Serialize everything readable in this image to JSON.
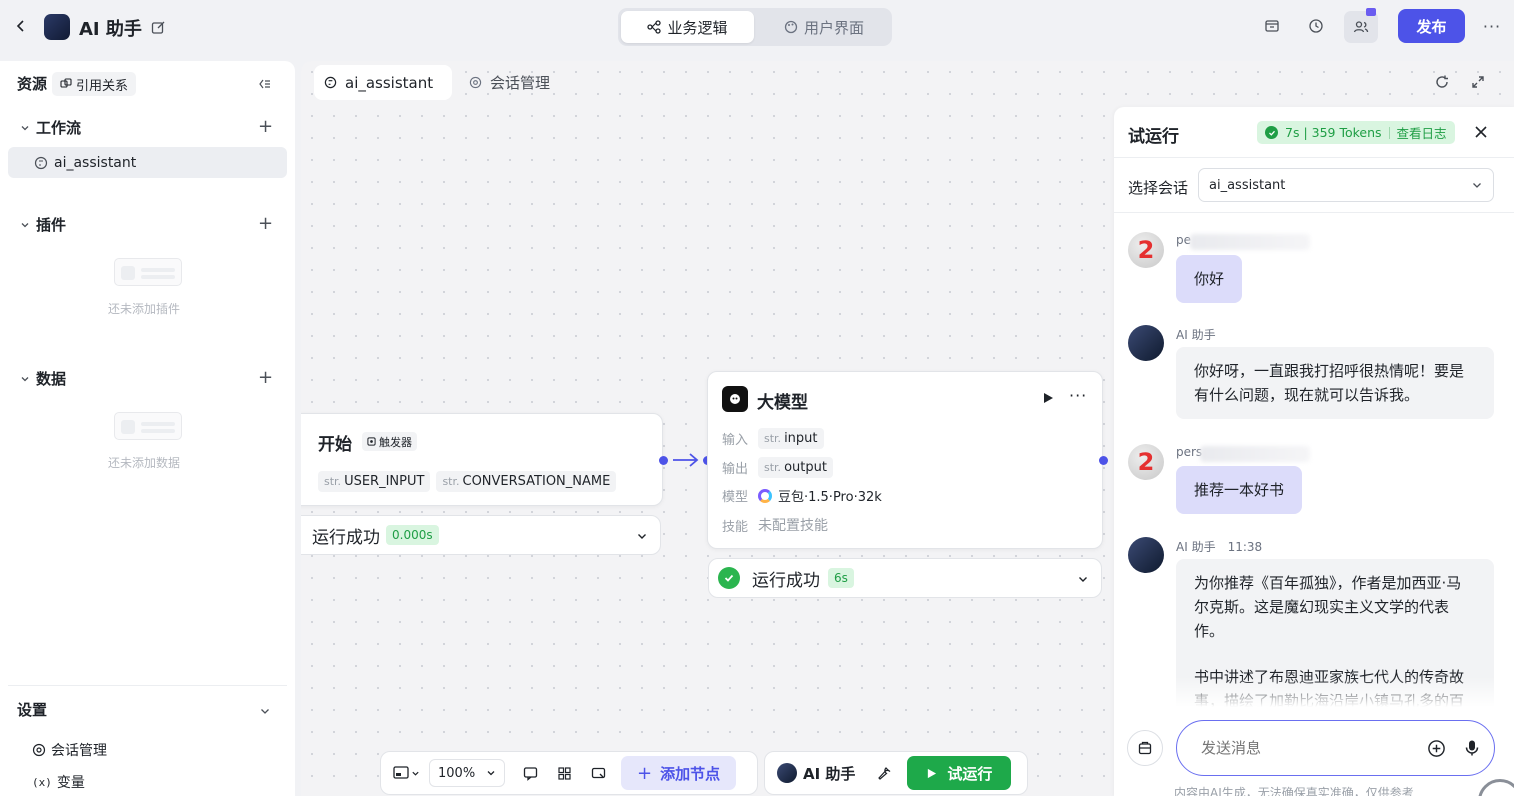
{
  "header": {
    "app_title": "AI 助手",
    "tabs": [
      {
        "label": "业务逻辑",
        "active": true
      },
      {
        "label": "用户界面",
        "active": false
      }
    ],
    "publish_label": "发布"
  },
  "sidebar": {
    "title": "资源",
    "ref_label": "引用关系",
    "workflow_title": "工作流",
    "workflow_items": [
      "ai_assistant"
    ],
    "plugin_title": "插件",
    "plugin_empty": "还未添加插件",
    "data_title": "数据",
    "data_empty": "还未添加数据",
    "settings_title": "设置",
    "settings_items": [
      "会话管理",
      "变量"
    ]
  },
  "canvas": {
    "tabs": [
      "ai_assistant",
      "会话管理"
    ],
    "start_node": {
      "title": "开始",
      "badge": "触发器",
      "params": [
        {
          "type": "str.",
          "name": "USER_INPUT"
        },
        {
          "type": "str.",
          "name": "CONVERSATION_NAME"
        }
      ],
      "status": "运行成功",
      "time": "0.000s"
    },
    "llm_node": {
      "title": "大模型",
      "input_label": "输入",
      "input_type": "str.",
      "input_name": "input",
      "output_label": "输出",
      "output_type": "str.",
      "output_name": "output",
      "model_label": "模型",
      "model_name": "豆包·1.5·Pro·32k",
      "skill_label": "技能",
      "skill_value": "未配置技能",
      "status": "运行成功",
      "time": "6s"
    },
    "toolbar": {
      "zoom": "100%",
      "add_node": "添加节点",
      "bot_name": "AI 助手",
      "run_label": "试运行"
    }
  },
  "panel": {
    "title": "试运行",
    "stats": "7s | 359 Tokens",
    "log_link": "查看日志",
    "select_label": "选择会话",
    "select_value": "ai_assistant",
    "messages": [
      {
        "role": "user",
        "name": "pe",
        "text": "你好"
      },
      {
        "role": "ai",
        "name": "AI 助手",
        "time": "",
        "text": "你好呀，一直跟我打招呼很热情呢！要是有什么问题，现在就可以告诉我。"
      },
      {
        "role": "user",
        "name": "pers",
        "text": "推荐一本好书"
      },
      {
        "role": "ai",
        "name": "AI 助手",
        "time": "11:38",
        "text": "为你推荐《百年孤独》，作者是加西亚·马尔克斯。这是魔幻现实主义文学的代表作。",
        "text2": "书中讲述了布恩迪亚家族七代人的传奇故事，描绘了加勒比海沿岸小镇马孔多的百"
      }
    ],
    "input_placeholder": "发送消息",
    "disclaimer": "内容由AI生成，无法确保真实准确，仅供参考"
  }
}
